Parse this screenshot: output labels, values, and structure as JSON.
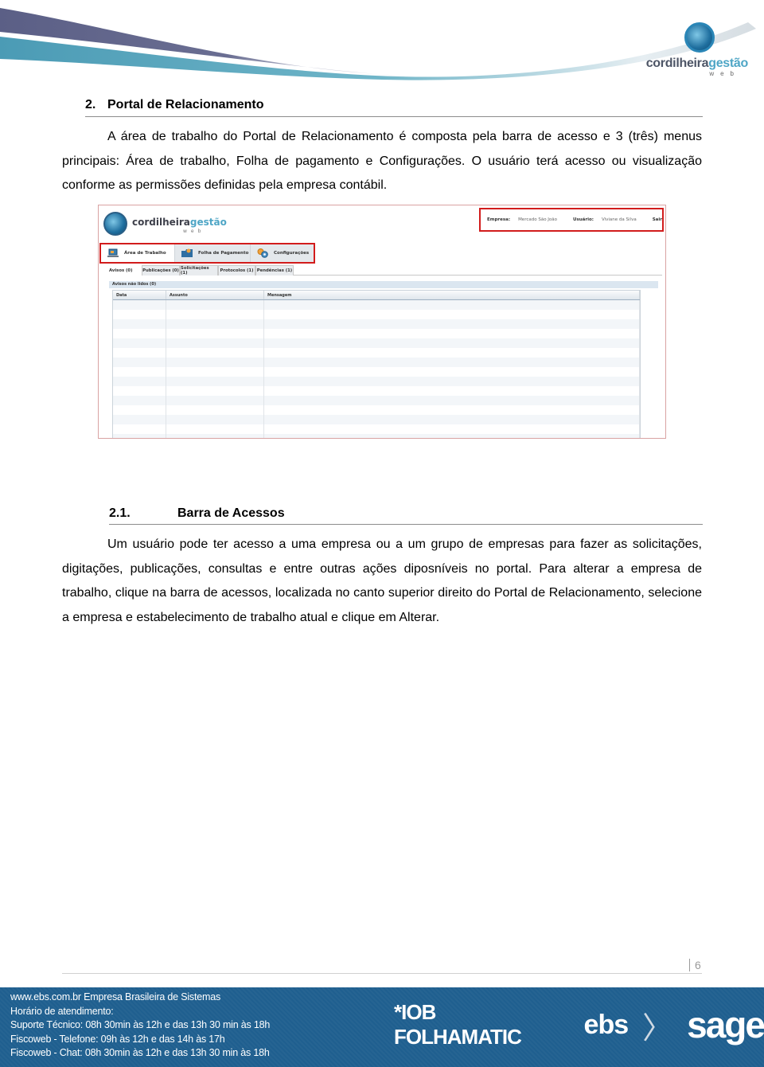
{
  "header": {
    "brand_name_main": "cordilheira",
    "brand_name_accent": "gestão",
    "brand_sub": "web"
  },
  "section": {
    "number": "2.",
    "title": "Portal de Relacionamento",
    "paragraph": "A área de trabalho do Portal de Relacionamento é composta pela barra de acesso e 3 (três) menus principais: Área de trabalho, Folha de pagamento e Configurações. O usuário terá acesso ou visualização conforme as permissões definidas pela empresa contábil."
  },
  "figure": {
    "logo_main": "cordilheira",
    "logo_accent": "gestão",
    "logo_sub": "web",
    "access_bar": {
      "company_label": "Empresa:",
      "company_value": "Mercado São João",
      "user_label": "Usuário:",
      "user_value": "Viviane da Silva",
      "logout": "Sair"
    },
    "main_menu": [
      {
        "label": "Área de Trabalho",
        "icon": "monitor-icon"
      },
      {
        "label": "Folha de Pagamento",
        "icon": "folder-icon"
      },
      {
        "label": "Configurações",
        "icon": "gears-icon"
      }
    ],
    "sub_tabs": [
      {
        "label": "Avisos (0)"
      },
      {
        "label": "Publicações (0)"
      },
      {
        "label": "Solicitações (1)"
      },
      {
        "label": "Protocolos (1)"
      },
      {
        "label": "Pendências (1)"
      }
    ],
    "panel_title": "Avisos não lidos (0)",
    "grid_columns": [
      "Data",
      "Assunto",
      "Mensagem"
    ]
  },
  "subsection": {
    "number": "2.1.",
    "title": "Barra de Acessos",
    "paragraph": "Um usuário pode ter acesso a uma empresa ou a um grupo de empresas para fazer as solicitações, digitações, publicações, consultas e entre outras ações  diposníveis no portal. Para alterar a empresa de trabalho, clique na barra de acessos, localizada no canto superior direito do Portal de Relacionamento, selecione a empresa e estabelecimento de trabalho atual e clique em Alterar."
  },
  "page_number": "6",
  "footer": {
    "lines": [
      "www.ebs.com.br Empresa Brasileira de Sistemas",
      "Horário de atendimento:",
      "Suporte Técnico: 08h 30min às 12h e das 13h 30 min às 18h",
      "Fiscoweb - Telefone: 09h às 12h e das 14h às 17h",
      "Fiscoweb - Chat: 08h 30min às 12h e das 13h 30 min às 18h"
    ],
    "logos": {
      "iob": "*IOB FOLHAMATIC",
      "ebs": "ebs",
      "chevron": "〉",
      "sage": "sage"
    }
  },
  "colors": {
    "highlight_border": "#d21c1c",
    "footer_bg": "#1f5f8f",
    "brand_accent": "#4fa6c6",
    "swoosh_dark": "#5b5f86",
    "swoosh_light": "#4b9bb5"
  }
}
